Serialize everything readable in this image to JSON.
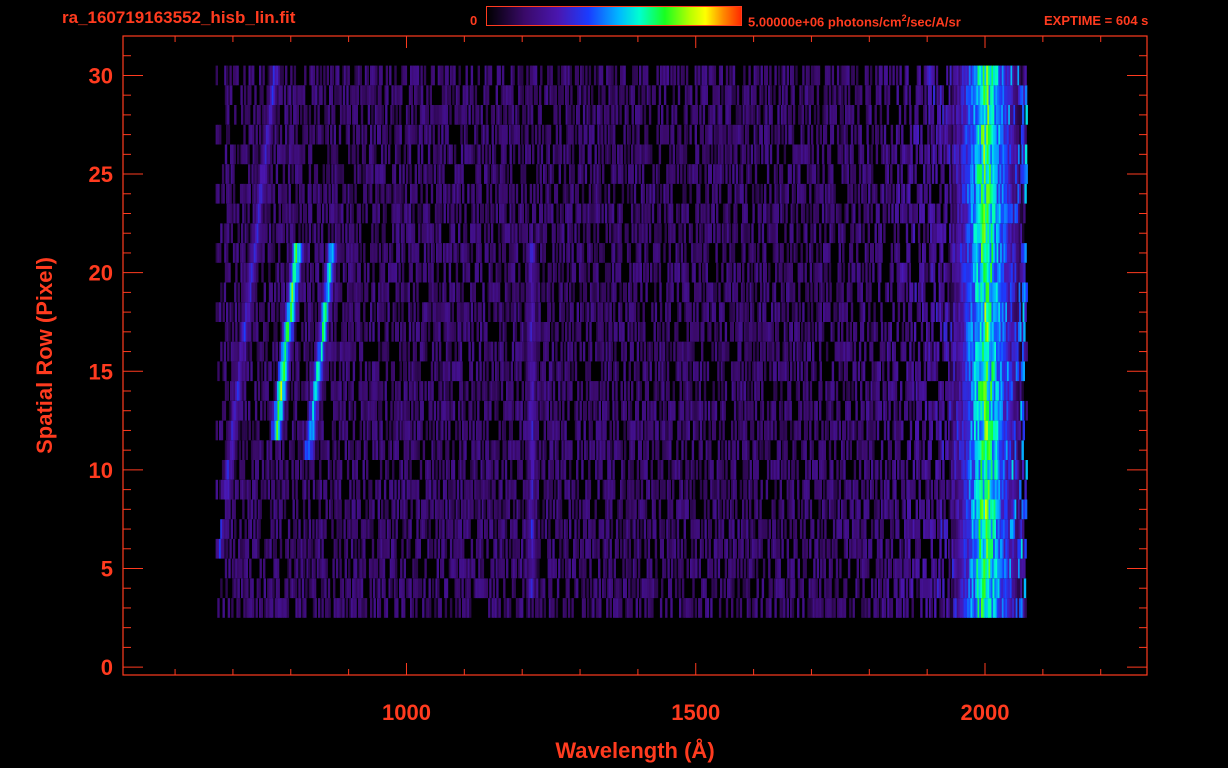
{
  "header": {
    "file_title": "ra_160719163552_hisb_lin.fit",
    "colorbar_min": "0",
    "colorbar_max_prefix": "5.00000e+06 photons/cm",
    "colorbar_max_sup": "2",
    "colorbar_max_suffix": "/sec/A/sr",
    "exptime": "EXPTIME = 604 s"
  },
  "colors": {
    "axis": "#ff3b1f",
    "background": "#000000"
  },
  "chart_data": {
    "type": "heatmap",
    "xlabel": "Wavelength (Å)",
    "ylabel": "Spatial Row (Pixel)",
    "xlim": [
      510,
      2280
    ],
    "ylim": [
      -0.4,
      32
    ],
    "x_ticks": [
      1000,
      1500,
      2000
    ],
    "x_tick_labels": [
      "1000",
      "1500",
      "2000"
    ],
    "y_ticks": [
      0,
      5,
      10,
      15,
      20,
      25,
      30
    ],
    "y_tick_labels": [
      "0",
      "5",
      "10",
      "15",
      "20",
      "25",
      "30"
    ],
    "x_minor_step": 100,
    "y_minor_step": 1,
    "colorbar": {
      "min": 0,
      "max": 5000000,
      "unit": "photons/cm²/sec/A/sr"
    },
    "data_extent": {
      "x": [
        680,
        2070
      ],
      "rows": [
        3,
        30
      ]
    },
    "features": [
      {
        "x_center": 715,
        "rows": [
          4,
          30
        ],
        "peak_fraction": 0.35
      },
      {
        "x_center": 790,
        "rows": [
          12,
          21
        ],
        "peak_fraction": 0.78
      },
      {
        "x_center": 850,
        "rows": [
          11,
          21
        ],
        "peak_fraction": 0.62
      },
      {
        "x_center": 1215,
        "rows": [
          4,
          21
        ],
        "peak_fraction": 0.32
      },
      {
        "x_center": 2000,
        "rows": [
          3,
          30
        ],
        "peak_fraction": 0.7
      }
    ]
  }
}
